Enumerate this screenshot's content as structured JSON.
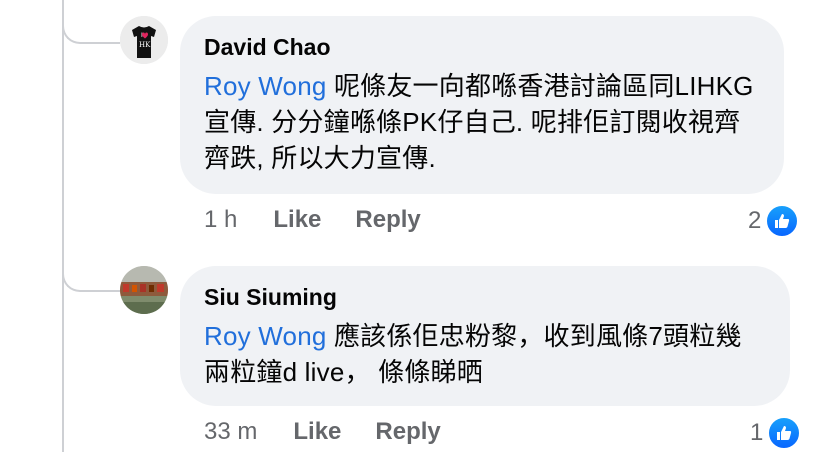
{
  "comments": [
    {
      "author": "David Chao",
      "mention": "Roy Wong",
      "text": " 呢條友一向都喺香港討論區同LIHKG宣傳. 分分鐘喺條PK仔自己. 呢排佢訂閱收視齊齊跌, 所以大力宣傳.",
      "time": "1 h",
      "like_label": "Like",
      "reply_label": "Reply",
      "reaction_count": "2",
      "avatar_icon": "black-tshirt-i-love-hk-icon"
    },
    {
      "author": "Siu Siuming",
      "mention": "Roy Wong",
      "text": " 應該係佢忠粉黎，收到風條7頭粒幾兩粒鐘d live，  條條睇晒",
      "time": "33 m",
      "like_label": "Like",
      "reply_label": "Reply",
      "reaction_count": "1",
      "avatar_icon": "crowd-photo-icon"
    }
  ],
  "colors": {
    "bubble_bg": "#f0f2f5",
    "mention": "#216fdb",
    "meta_text": "#65676b",
    "like_badge": "#0866ff"
  }
}
